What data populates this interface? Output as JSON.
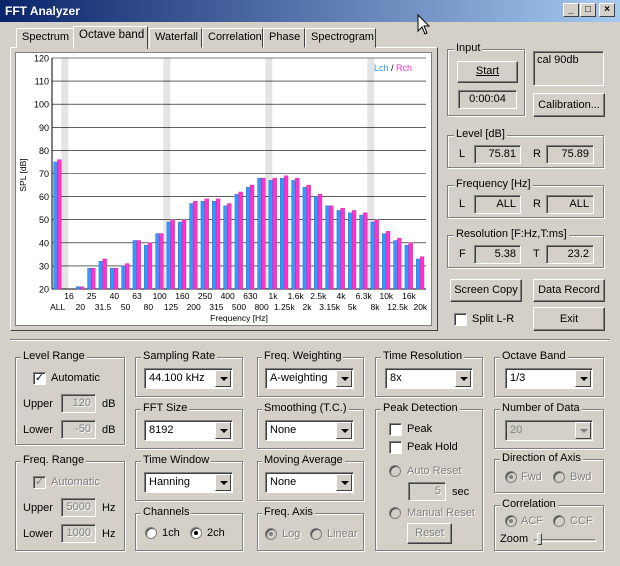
{
  "window": {
    "title": "FFT Analyzer",
    "minimize": "_",
    "maximize": "□",
    "close": "×"
  },
  "tabs": [
    {
      "label": "Spectrum"
    },
    {
      "label": "Octave band"
    },
    {
      "label": "Waterfall"
    },
    {
      "label": "Correlation"
    },
    {
      "label": "Phase"
    },
    {
      "label": "Spectrogram"
    }
  ],
  "chart_data": {
    "type": "bar",
    "ylabel": "SPL [dB]",
    "xlabel": "Frequency [Hz]",
    "ylim": [
      20,
      120
    ],
    "yticks": [
      20,
      30,
      40,
      50,
      60,
      70,
      80,
      90,
      100,
      110,
      120
    ],
    "legend": {
      "left": "Lch",
      "sep": " / ",
      "right": "Rch",
      "position": "top-right"
    },
    "colors": {
      "left": "#3399ff",
      "right": "#ff33cc",
      "grid": "#c0c0c0"
    },
    "categories": [
      "ALL",
      "16",
      "20",
      "25",
      "31.5",
      "40",
      "50",
      "63",
      "80",
      "100",
      "125",
      "160",
      "200",
      "250",
      "315",
      "400",
      "500",
      "630",
      "800",
      "1k",
      "1.25k",
      "1.6k",
      "2k",
      "2.5k",
      "3.15k",
      "4k",
      "5k",
      "6.3k",
      "8k",
      "10k",
      "12.5k",
      "16k",
      "20k"
    ],
    "tick_row1": [
      "16",
      "25",
      "40",
      "63",
      "100",
      "160",
      "250",
      "400",
      "630",
      "1k",
      "1.6k",
      "2.5k",
      "4k",
      "6.3k",
      "10k",
      "16k"
    ],
    "tick_row2": [
      "ALL",
      "20",
      "31.5",
      "50",
      "80",
      "125",
      "200",
      "315",
      "500",
      "800",
      "1.25k",
      "2k",
      "3.15k",
      "5k",
      "8k",
      "12.5k",
      "20k"
    ],
    "series": [
      {
        "name": "Lch",
        "values": [
          75,
          20,
          21,
          29,
          32,
          29,
          30,
          41,
          39,
          44,
          49,
          49,
          57,
          58,
          58,
          56,
          61,
          64,
          68,
          67,
          68,
          67,
          64,
          60,
          56,
          54,
          53,
          52,
          49,
          44,
          41,
          39,
          33
        ]
      },
      {
        "name": "Rch",
        "values": [
          76,
          20,
          21,
          29,
          33,
          29,
          31,
          41,
          40,
          44,
          50,
          50,
          58,
          59,
          59,
          57,
          62,
          65,
          68,
          68,
          69,
          68,
          65,
          61,
          56,
          55,
          54,
          53,
          50,
          45,
          42,
          40,
          34
        ]
      }
    ]
  },
  "input": {
    "label": "Input",
    "start": "Start",
    "elapsed": "0:00:04",
    "cal": "cal 90db",
    "calibration": "Calibration..."
  },
  "level": {
    "label": "Level [dB]",
    "l_label": "L",
    "l_value": "75.81",
    "r_label": "R",
    "r_value": "75.89"
  },
  "frequency": {
    "label": "Frequency [Hz]",
    "l_label": "L",
    "l_value": "ALL",
    "r_label": "R",
    "r_value": "ALL"
  },
  "resolution": {
    "label": "Resolution [F:Hz,T:ms]",
    "f_label": "F",
    "f_value": "5.38",
    "t_label": "T",
    "t_value": "23.2"
  },
  "buttons": {
    "screen_copy": "Screen Copy",
    "data_record": "Data Record",
    "split": "Split L-R",
    "exit": "Exit"
  },
  "level_range": {
    "label": "Level Range",
    "automatic": "Automatic",
    "upper_label": "Upper",
    "upper": "120",
    "upper_unit": "dB",
    "lower_label": "Lower",
    "lower": "-50",
    "lower_unit": "dB"
  },
  "freq_range": {
    "label": "Freq. Range",
    "automatic": "Automatic",
    "upper_label": "Upper",
    "upper": "5000",
    "upper_unit": "Hz",
    "lower_label": "Lower",
    "lower": "1000",
    "lower_unit": "Hz"
  },
  "sampling_rate": {
    "label": "Sampling Rate",
    "value": "44.100 kHz"
  },
  "fft_size": {
    "label": "FFT Size",
    "value": "8192"
  },
  "time_window": {
    "label": "Time Window",
    "value": "Hanning"
  },
  "channels": {
    "label": "Channels",
    "opt1": "1ch",
    "opt2": "2ch"
  },
  "freq_weighting": {
    "label": "Freq. Weighting",
    "value": "A-weighting"
  },
  "smoothing": {
    "label": "Smoothing (T.C.)",
    "value": "None"
  },
  "moving_average": {
    "label": "Moving Average",
    "value": "None"
  },
  "freq_axis": {
    "label": "Freq. Axis",
    "opt1": "Log",
    "opt2": "Linear"
  },
  "time_resolution": {
    "label": "Time Resolution",
    "value": "8x"
  },
  "peak_detection": {
    "label": "Peak Detection",
    "peak": "Peak",
    "peak_hold": "Peak Hold",
    "auto_reset": "Auto Reset",
    "seconds": "5",
    "sec_unit": "sec",
    "manual_reset": "Manual Reset",
    "reset": "Reset"
  },
  "octave_band": {
    "label": "Octave Band",
    "value": "1/3"
  },
  "number_of_data": {
    "label": "Number of Data",
    "value": "20"
  },
  "direction": {
    "label": "Direction of Axis",
    "opt1": "Fwd",
    "opt2": "Bwd"
  },
  "correlation": {
    "label": "Correlation",
    "opt1": "ACF",
    "opt2": "CCF",
    "zoom": "Zoom"
  }
}
